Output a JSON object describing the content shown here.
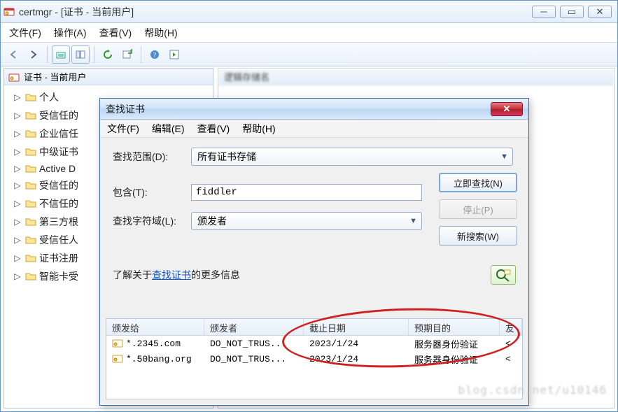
{
  "main": {
    "title": "certmgr - [证书 - 当前用户]",
    "menu": {
      "file": "文件(F)",
      "action": "操作(A)",
      "view": "查看(V)",
      "help": "帮助(H)"
    },
    "tree_title": "证书 - 当前用户",
    "tree": [
      "个人",
      "受信任的",
      "企业信任",
      "中级证书",
      "Active D",
      "受信任的",
      "不信任的",
      "第三方根",
      "受信任人",
      "证书注册",
      "智能卡受"
    ],
    "listhdr": "逻辑存储名"
  },
  "dlg": {
    "title": "查找证书",
    "menu": {
      "file": "文件(F)",
      "edit": "编辑(E)",
      "view": "查看(V)",
      "help": "帮助(H)"
    },
    "scope_label": "查找范围(D):",
    "scope_value": "所有证书存储",
    "contains_label": "包含(T):",
    "contains_value": "fiddler",
    "field_label": "查找字符域(L):",
    "field_value": "颁发者",
    "btn_find": "立即查找(N)",
    "btn_stop": "停止(P)",
    "btn_new": "新搜索(W)",
    "info_prefix": "了解关于",
    "info_link": "查找证书",
    "info_suffix": "的更多信息",
    "cols": {
      "issuedto": "颁发给",
      "issuer": "颁发者",
      "expiry": "截止日期",
      "purpose": "预期目的",
      "friendly": "友"
    },
    "rows": [
      {
        "issuedto": "*.2345.com",
        "issuer": "DO_NOT_TRUS...",
        "expiry": "2023/1/24",
        "purpose": "服务器身份验证",
        "friendly": "<"
      },
      {
        "issuedto": "*.50bang.org",
        "issuer": "DO_NOT_TRUS...",
        "expiry": "2023/1/24",
        "purpose": "服务器身份验证",
        "friendly": "<"
      }
    ]
  },
  "watermark": "blog.csdn.net/u10146"
}
